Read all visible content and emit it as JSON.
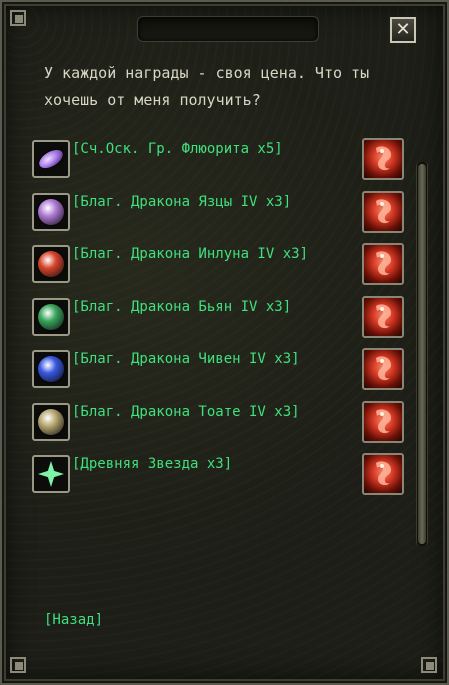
{
  "window": {
    "title": "",
    "close_icon": "✕"
  },
  "dialog": {
    "text": "У каждой награды - своя цена. Что ты\nхочешь от меня получить?"
  },
  "rewards": [
    {
      "label": "[Сч.Оск. Гр. Флюорита x5]",
      "icon": "fluorite-shard-icon",
      "color": "#a77be8"
    },
    {
      "label": "[Благ. Дракона Язцы IV x3]",
      "icon": "dragon-orb-purple-icon",
      "color": "#b07bd6"
    },
    {
      "label": "[Благ. Дракона Инлуна IV x3]",
      "icon": "dragon-orb-red-icon",
      "color": "#d8452a"
    },
    {
      "label": "[Благ. Дракона Бьян IV x3]",
      "icon": "dragon-orb-green-icon",
      "color": "#39a55c"
    },
    {
      "label": "[Благ. Дракона Чивен IV x3]",
      "icon": "dragon-orb-blue-icon",
      "color": "#3858e0"
    },
    {
      "label": "[Благ. Дракона Тоате IV x3]",
      "icon": "dragon-orb-gold-icon",
      "color": "#b8a770"
    },
    {
      "label": "[Древняя Звезда x3]",
      "icon": "ancient-star-icon",
      "color": "#7ff2a8"
    }
  ],
  "reward_button_icon": "dragon-claim-icon",
  "back": {
    "label": "[Назад]"
  },
  "colors": {
    "link_green": "#3fe07d",
    "text": "#d8d6c4"
  }
}
